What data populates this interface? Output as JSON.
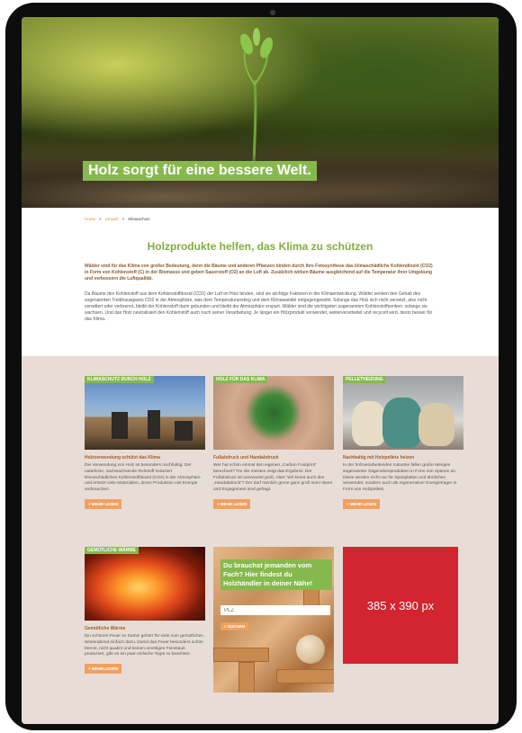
{
  "hero": {
    "title": "Holz sorgt für eine bessere Welt."
  },
  "breadcrumb": {
    "items": [
      "Home",
      "Umwelt",
      "Klimaschutz"
    ],
    "separator": ">"
  },
  "main": {
    "headline": "Holzprodukte helfen, das Klima zu schützen",
    "lead": "Wälder sind für das Klima von großer Bedeutung, denn die Bäume und anderen Pflanzen binden durch ihre Fotosynthese das klimaschädliche Kohlendioxid (CO2) in Form von Kohlenstoff (C) in der Biomasse und geben Sauerstoff (O2) an die Luft ab. Zusätzlich wirken Bäume ausgleichend auf die Temperatur ihrer Umgebung und verbessern die Luftqualität.",
    "body": "Da Bäume den Kohlenstoff aus dem Kohlenstoffdioxid (CO2) der Luft im Holz binden, sind sie wichtige Faktoren in der Klimaentwicklung. Wälder senken den Gehalt des sogenannten Treibhausgases CO2 in der Atmosphäre, was dem Temperaturanstieg und dem Klimawandel entgegengewirkt. Solange das Holz sich nicht zersetzt, also nicht verwittert oder verbrennt, bleibt der Kohlenstoff darin gebunden und bleibt der Atmosphäre erspart. Wälder sind die wichtigsten sogenannten Kohlenstoffsenken, solange sie wachsen. Und das Holz neutralisiert den Kohlenstoff auch nach seiner Verarbeitung: Je länger ein Holzprodukt verwendet, weiterverarbeitet und recycelt wird, desto besser für das Klima."
  },
  "cards": [
    {
      "tag": "Klimaschutz durch Holz",
      "title": "Holzverwendung schützt das Klima",
      "text": "Die Verwendung von Holz ist besonders nachhaltig: Der natürliche, nachwachsende Rohstoff reduziert klimaschädliches Kohlenstoffdioxid (CO2) in der Atmosphäre und ersetzt viele Materialien, deren Produktion viel Energie verbrauchen.",
      "button": "+ MEHR LESEN"
    },
    {
      "tag": "Holz für das Klima",
      "title": "Fußabdruck und Handabdruck",
      "text": "Wer hat schon einmal den eigenen „Carbon Footprint“ berechnet? Für die meisten zeigt das Ergebnis: Der Fußabdruck ist unerwartet groß. Aber: Wir kennt auch den „Handabdruck“? Der darf nämlich gerne ganz groß sein! Ideen und Engagement sind gefragt.",
      "button": "+ MEHR LESEN"
    },
    {
      "tag": "Pelletheizung",
      "title": "Nachhaltig mit Holzpellets heizen",
      "text": "In der holzverarbeitenden Industrie fallen große Mengen sogenannter Sägenebenprodukten in Form von Spänen an. Diese werden nicht nur für Spanplatten und ähnliches verwendet, sondern auch als regenerativer Energieträger in Form von Holzpellets.",
      "button": "+ MEHR LESEN"
    },
    {
      "tag": "Gemütliche Wärme",
      "title": "Gemütliche Wärme",
      "text": "Ein schönes Feuer im Kamin gehört für viele zum gemütlichen Winterabend einfach dazu. Damit das Feuer besonders schön brennt, nicht qualmt und keinen unnötigen Feinstaub produziert, gibt es ein paar einfache Tipps zu beachten.",
      "button": "+ MEHR LESEN"
    }
  ],
  "search": {
    "question": "Du brauchst jemanden vom Fach? Hier findest du Holzhändler in deiner Nähe!",
    "placeholder": "PLZ",
    "button": "> SUCHEN"
  },
  "ad": {
    "label": "385 x 390 px",
    "color": "#d32431"
  },
  "colors": {
    "accent_green": "#86b94d",
    "accent_orange": "#f0a060",
    "link": "#e98d3a",
    "section_bg": "#e7ddd6"
  }
}
